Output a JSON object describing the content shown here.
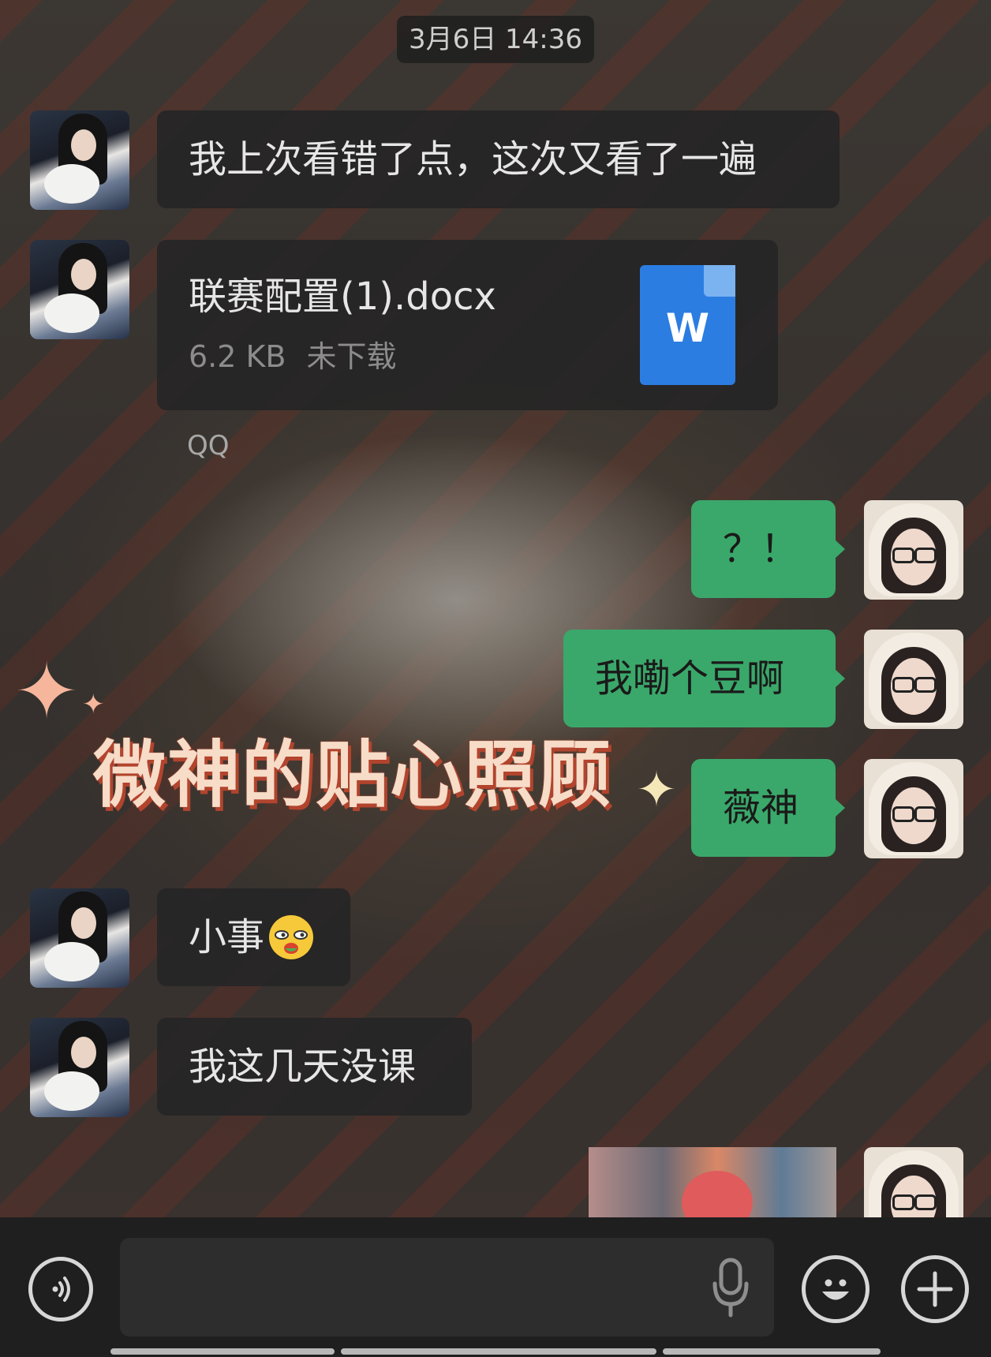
{
  "timestamp": "3月6日 14:36",
  "messages": {
    "m1": {
      "text": "我上次看错了点，这次又看了一遍"
    },
    "m2": {
      "file_name": "联赛配置(1).docx",
      "file_size": "6.2 KB",
      "file_status": "未下载",
      "file_icon_letter": "W",
      "source": "QQ"
    },
    "m3": {
      "text": "？！"
    },
    "m4": {
      "text": "我嘞个豆啊"
    },
    "m5": {
      "text": "薇神"
    },
    "m6": {
      "text": "小事"
    },
    "m7": {
      "text": "我这几天没课"
    }
  },
  "overlay": {
    "caption": "微神的贴心照顾"
  },
  "input_bar": {
    "placeholder": "",
    "icons": [
      "voice-toggle-icon",
      "microphone-icon",
      "emoji-icon",
      "plus-icon"
    ]
  },
  "colors": {
    "sent_bubble": "#3aa86a",
    "received_bubble": "#262626",
    "doc_icon": "#2b7de1",
    "caption": "#f7dcc8",
    "caption_shadow": "#b2442d"
  }
}
